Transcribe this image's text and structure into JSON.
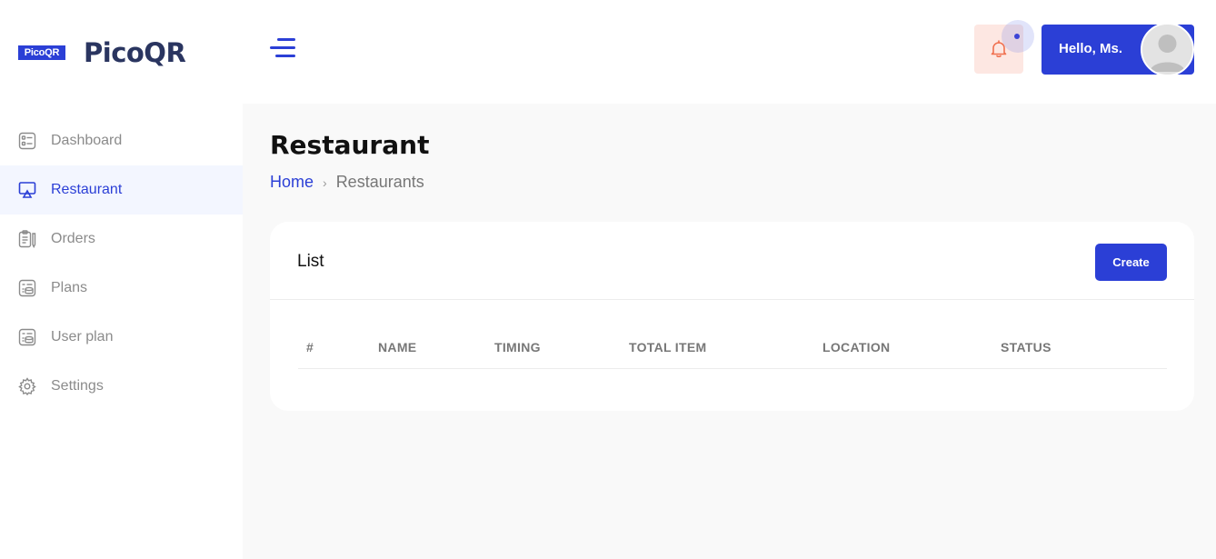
{
  "brand": {
    "logo_text": "PicoQR",
    "name": "PicoQR",
    "accent_color": "#2b3fd6"
  },
  "sidebar": {
    "items": [
      {
        "label": "Dashboard",
        "icon": "dashboard-icon",
        "active": false
      },
      {
        "label": "Restaurant",
        "icon": "monitor-icon",
        "active": true
      },
      {
        "label": "Orders",
        "icon": "clipboard-icon",
        "active": false
      },
      {
        "label": "Plans",
        "icon": "layers-list-icon",
        "active": false
      },
      {
        "label": "User plan",
        "icon": "layers-list-icon",
        "active": false
      },
      {
        "label": "Settings",
        "icon": "gear-icon",
        "active": false
      }
    ]
  },
  "header": {
    "menu_icon": "hamburger-icon",
    "notification_icon": "bell-icon",
    "user_greeting": "Hello, Ms.",
    "avatar_icon": "user-avatar-icon"
  },
  "page": {
    "title": "Restaurant",
    "breadcrumb": {
      "home": "Home",
      "separator": "›",
      "current": "Restaurants"
    }
  },
  "card": {
    "title": "List",
    "create_label": "Create",
    "columns": [
      "#",
      "NAME",
      "TIMING",
      "TOTAL ITEM",
      "LOCATION",
      "STATUS"
    ]
  }
}
